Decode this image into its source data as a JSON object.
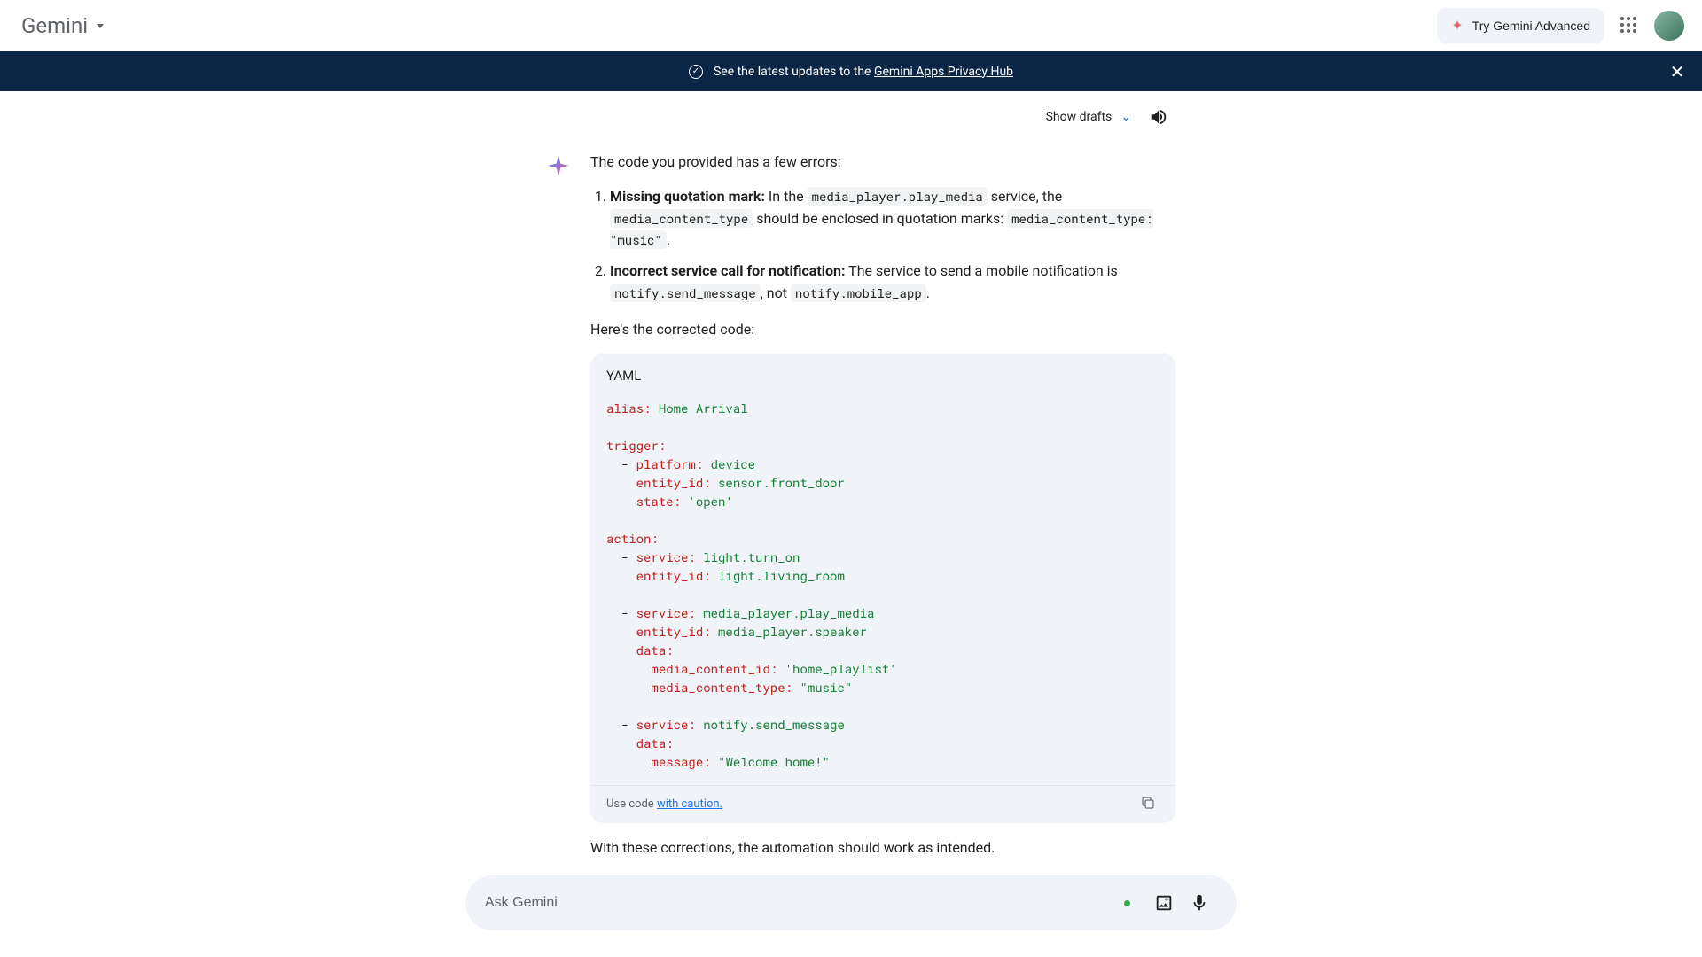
{
  "header": {
    "logo": "Gemini",
    "try_advanced": "Try Gemini Advanced"
  },
  "banner": {
    "text": "See the latest updates to the ",
    "link": "Gemini Apps Privacy Hub"
  },
  "actions": {
    "show_drafts": "Show drafts"
  },
  "response": {
    "intro": "The code you provided has a few errors:",
    "errors": [
      {
        "num": "1.",
        "title": "Missing quotation mark:",
        "seg1": " In the ",
        "code1": "media_player.play_media",
        "seg2": " service, the ",
        "code2": "media_content_type",
        "seg3": " should be enclosed in quotation marks: ",
        "code3": "media_content_type: \"music\"",
        "seg4": "."
      },
      {
        "num": "2.",
        "title": "Incorrect service call for notification:",
        "seg1": " The service to send a mobile notification is ",
        "code1": "notify.send_message",
        "seg2": ", not ",
        "code2": "notify.mobile_app",
        "seg3": "."
      }
    ],
    "corrected_intro": "Here's the corrected code:",
    "code_lang": "YAML",
    "code": {
      "k_alias": "alias:",
      "v_alias": " Home Arrival",
      "k_trigger": "trigger:",
      "d1": "  - ",
      "k_platform": "platform:",
      "v_platform": " device",
      "sp4": "    ",
      "k_eid": "entity_id:",
      "v_eid1": " sensor.front_door",
      "k_state": "state:",
      "v_state": " 'open'",
      "k_action": "action:",
      "k_service": "service:",
      "v_serv1": " light.turn_on",
      "v_eid2": " light.living_room",
      "v_serv2": " media_player.play_media",
      "v_eid3": " media_player.speaker",
      "k_data": "data:",
      "sp6": "      ",
      "k_mcid": "media_content_id:",
      "v_mcid": " 'home_playlist'",
      "k_mct": "media_content_type:",
      "v_mct": " \"music\"",
      "v_serv3": " notify.send_message",
      "k_msg": "message:",
      "v_msg": " \"Welcome home!\""
    },
    "caution_pre": "Use code ",
    "caution_link": "with caution.",
    "closing": "With these corrections, the automation should work as intended."
  },
  "input": {
    "placeholder": "Ask Gemini"
  }
}
